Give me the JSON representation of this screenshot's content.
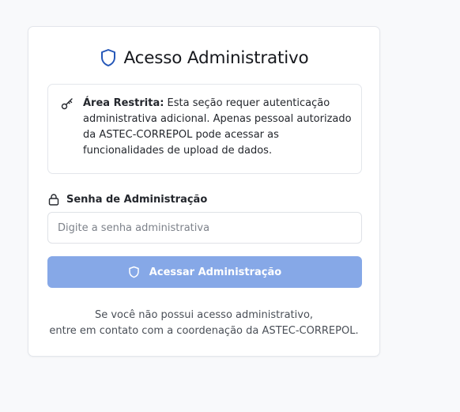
{
  "card": {
    "title": "Acesso Administrativo",
    "title_icon": "shield-icon"
  },
  "notice": {
    "icon": "key-icon",
    "bold_label": "Área Restrita:",
    "text": " Esta seção requer autenticação administrativa adicional. Apenas pessoal autorizado da ASTEC-CORREPOL pode acessar as funcionalidades de upload de dados."
  },
  "password": {
    "icon": "lock-icon",
    "label": "Senha de Administração",
    "value": "",
    "placeholder": "Digite a senha administrativa"
  },
  "submit": {
    "icon": "shield-icon",
    "label": "Acessar Administração",
    "disabled": true
  },
  "footer": {
    "line1": "Se você não possui acesso administrativo,",
    "line2": "entre em contato com a coordenação da ASTEC-CORREPOL."
  },
  "colors": {
    "accent": "#2557b8",
    "button_disabled": "#86a8e7",
    "page_background": "#f8f9fb",
    "card_border": "#e3e6eb"
  }
}
